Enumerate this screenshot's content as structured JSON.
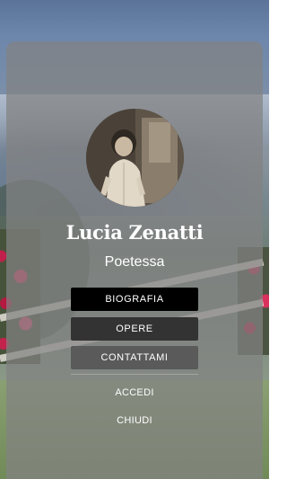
{
  "profile": {
    "name": "Lucia Zenatti",
    "role": "Poetessa",
    "photo_icon": "portrait-photo"
  },
  "menu": {
    "biography_label": "BIOGRAFIA",
    "works_label": "OPERE",
    "contact_label": "CONTATTAMI",
    "login_label": "ACCEDI",
    "close_label": "CHIUDI"
  },
  "colors": {
    "overlay": "#828282",
    "button_active": "#000000",
    "button_dark": "#333333",
    "button_mid": "#5a5a5a",
    "text": "#ffffff"
  }
}
